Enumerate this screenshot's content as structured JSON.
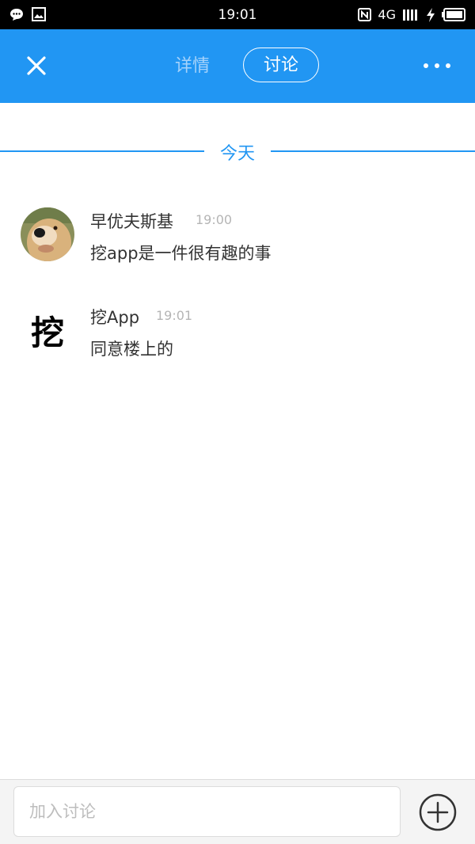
{
  "status_bar": {
    "time": "19:01",
    "network": "4G",
    "icons": [
      "chat-bubble-icon",
      "image-icon",
      "nfc-icon",
      "signal-icon",
      "charging-icon",
      "battery-icon"
    ]
  },
  "header": {
    "tabs": [
      {
        "label": "详情",
        "active": false
      },
      {
        "label": "讨论",
        "active": true
      }
    ],
    "icons": [
      "close-icon",
      "more-icon"
    ],
    "background": "#2196f3"
  },
  "divider": {
    "label": "今天"
  },
  "messages": [
    {
      "name": "早优夫斯基",
      "time": "19:00",
      "text": "挖app是一件很有趣的事",
      "avatar": "dog-photo"
    },
    {
      "name": "挖App",
      "time": "19:01",
      "text": "同意楼上的",
      "avatar_glyph": "挖"
    }
  ],
  "composer": {
    "placeholder": "加入讨论",
    "icons": [
      "plus-circle-icon"
    ]
  }
}
